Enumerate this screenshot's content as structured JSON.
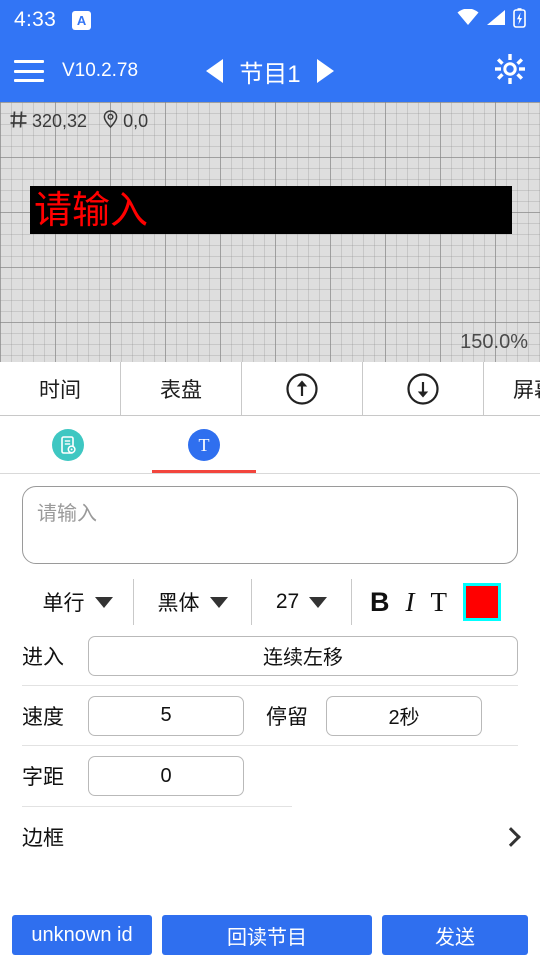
{
  "status_bar": {
    "time": "4:33",
    "ime_badge": "A",
    "wifi_icon": "wifi-icon",
    "signal_icon": "signal-icon",
    "battery_icon": "battery-charging-icon"
  },
  "app_bar": {
    "menu_icon": "hamburger-menu-icon",
    "version": "V10.2.78",
    "prev_icon": "previous-program-arrow-icon",
    "program_name": "节目1",
    "next_icon": "next-program-arrow-icon",
    "settings_icon": "gear-icon"
  },
  "canvas": {
    "size_icon": "screen-size-icon",
    "size_value": "320,32",
    "position_icon": "location-pin-icon",
    "position_value": "0,0",
    "led_text": "请输入",
    "led_text_color": "#ff0000",
    "led_background": "#000000",
    "zoom_level": "150.0%"
  },
  "object_toolbar": {
    "items": [
      {
        "label": "时间",
        "icon": ""
      },
      {
        "label": "表盘",
        "icon": ""
      },
      {
        "label": "",
        "icon": "arrow-up-circle-icon"
      },
      {
        "label": "",
        "icon": "arrow-down-circle-icon"
      },
      {
        "label": "屏幕亮",
        "icon": ""
      }
    ]
  },
  "tabs": [
    {
      "name": "program-settings-tab",
      "icon": "document-settings-icon",
      "glyph": "",
      "color": "#3ec7c2",
      "active": false
    },
    {
      "name": "text-tab",
      "icon": "text-T-icon",
      "glyph": "T",
      "color": "#2f6fef",
      "active": true
    }
  ],
  "text_panel": {
    "content_placeholder": "请输入",
    "content_value": "",
    "line_mode": "单行",
    "font_family": "黑体",
    "font_size": "27",
    "bold_label": "B",
    "italic_label": "I",
    "underline_label": "T",
    "color_value": "#ff0000",
    "color_border": "#00ffff",
    "enter_label": "进入",
    "enter_value": "连续左移",
    "speed_label": "速度",
    "speed_value": "5",
    "stay_label": "停留",
    "stay_value": "2秒",
    "spacing_label": "字距",
    "spacing_value": "0",
    "border_label": "边框",
    "border_chevron": "chevron-right-icon"
  },
  "bottom_bar": {
    "device_id": "unknown id",
    "readback_label": "回读节目",
    "send_label": "发送"
  },
  "colors": {
    "brand_blue": "#3275F5",
    "button_blue": "#2f6fef",
    "accent_red": "#f2453d",
    "teal": "#3ec7c2"
  }
}
